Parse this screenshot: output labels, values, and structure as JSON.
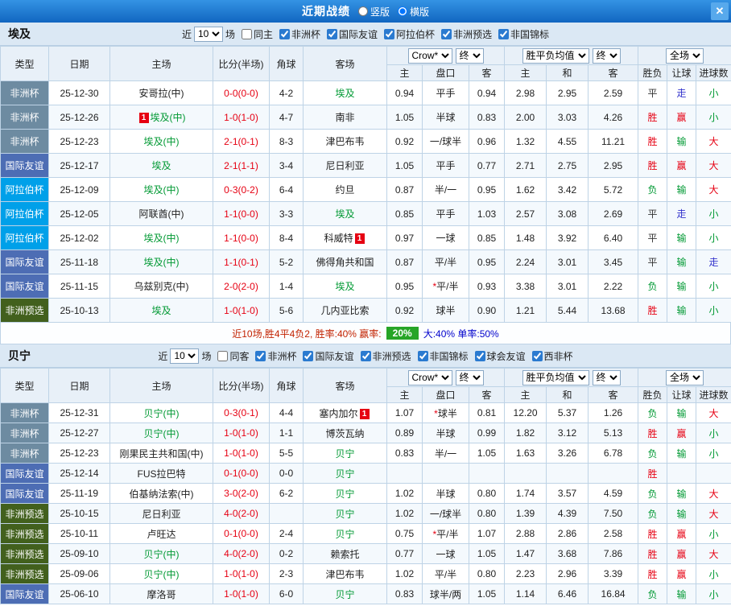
{
  "topbar": {
    "title": "近期战绩",
    "layout_options": [
      {
        "label": "竖版",
        "checked": false
      },
      {
        "label": "横版",
        "checked": true
      }
    ],
    "close_label": "✕"
  },
  "table": {
    "cols": [
      "类型",
      "日期",
      "主场",
      "比分(半场)",
      "角球",
      "客场"
    ],
    "asia_group": {
      "selects": [
        "Crow*",
        "终"
      ],
      "cols": [
        "主",
        "盘口",
        "客"
      ]
    },
    "europe_group": {
      "selects": [
        "胜平负均值",
        "终"
      ],
      "cols": [
        "主",
        "和",
        "客"
      ]
    },
    "result_group": {
      "select": "全场",
      "cols": [
        "胜负",
        "让球",
        "进球数"
      ]
    }
  },
  "colors": {
    "topbar_bg": "#1a74cc",
    "band_bg": "#dbe8f4",
    "score_red": "#e60012",
    "team_highlight": "#009933",
    "summary_badge_bg": "#27a527"
  },
  "type_colors": {
    "非洲杯": "#6d8ba1",
    "国际友谊": "#4d6db4",
    "阿拉伯杯": "#00a0e9",
    "非洲预选": "#42601d"
  },
  "result_colors": {
    "胜": "#e60012",
    "负": "#009933",
    "平": "#333333",
    "赢": "#e60012",
    "输": "#009933",
    "走": "#3333cc",
    "大": "#e60012",
    "小": "#009933"
  },
  "sections": [
    {
      "team": "埃及",
      "filter": {
        "near_label": "近",
        "near_value": "10",
        "unit_label": "场",
        "same_filter": {
          "label": "同主",
          "checked": false
        },
        "comps": [
          {
            "label": "非洲杯",
            "checked": true
          },
          {
            "label": "国际友谊",
            "checked": true
          },
          {
            "label": "阿拉伯杯",
            "checked": true
          },
          {
            "label": "非洲预选",
            "checked": true
          },
          {
            "label": "非国锦标",
            "checked": true
          }
        ]
      },
      "rows": [
        {
          "type": "非洲杯",
          "date": "25-12-30",
          "home": {
            "name": "安哥拉(中)",
            "green": false
          },
          "score": "0-0(0-0)",
          "corner": "4-2",
          "away": {
            "name": "埃及",
            "green": true
          },
          "odds": [
            "0.94",
            "平手",
            "0.94",
            "2.98",
            "2.95",
            "2.59"
          ],
          "results": [
            "平",
            "走",
            "小"
          ]
        },
        {
          "type": "非洲杯",
          "date": "25-12-26",
          "home": {
            "name": "埃及(中)",
            "green": true,
            "badge": "1",
            "badge_pos": "before"
          },
          "score": "1-0(1-0)",
          "corner": "4-7",
          "away": {
            "name": "南非",
            "green": false
          },
          "odds": [
            "1.05",
            "半球",
            "0.83",
            "2.00",
            "3.03",
            "4.26"
          ],
          "results": [
            "胜",
            "赢",
            "小"
          ]
        },
        {
          "type": "非洲杯",
          "date": "25-12-23",
          "home": {
            "name": "埃及(中)",
            "green": true
          },
          "score": "2-1(0-1)",
          "corner": "8-3",
          "away": {
            "name": "津巴布韦",
            "green": false
          },
          "odds": [
            "0.92",
            "一/球半",
            "0.96",
            "1.32",
            "4.55",
            "11.21"
          ],
          "results": [
            "胜",
            "输",
            "大"
          ]
        },
        {
          "type": "国际友谊",
          "date": "25-12-17",
          "home": {
            "name": "埃及",
            "green": true
          },
          "score": "2-1(1-1)",
          "corner": "3-4",
          "away": {
            "name": "尼日利亚",
            "green": false
          },
          "odds": [
            "1.05",
            "平手",
            "0.77",
            "2.71",
            "2.75",
            "2.95"
          ],
          "results": [
            "胜",
            "赢",
            "大"
          ]
        },
        {
          "type": "阿拉伯杯",
          "date": "25-12-09",
          "home": {
            "name": "埃及(中)",
            "green": true
          },
          "score": "0-3(0-2)",
          "corner": "6-4",
          "away": {
            "name": "约旦",
            "green": false
          },
          "odds": [
            "0.87",
            "半/一",
            "0.95",
            "1.62",
            "3.42",
            "5.72"
          ],
          "results": [
            "负",
            "输",
            "大"
          ]
        },
        {
          "type": "阿拉伯杯",
          "date": "25-12-05",
          "home": {
            "name": "阿联酋(中)",
            "green": false
          },
          "score": "1-1(0-0)",
          "corner": "3-3",
          "away": {
            "name": "埃及",
            "green": true
          },
          "odds": [
            "0.85",
            "平手",
            "1.03",
            "2.57",
            "3.08",
            "2.69"
          ],
          "results": [
            "平",
            "走",
            "小"
          ]
        },
        {
          "type": "阿拉伯杯",
          "date": "25-12-02",
          "home": {
            "name": "埃及(中)",
            "green": true
          },
          "score": "1-1(0-0)",
          "corner": "8-4",
          "away": {
            "name": "科威特",
            "green": false,
            "badge": "1",
            "badge_pos": "after"
          },
          "odds": [
            "0.97",
            "一球",
            "0.85",
            "1.48",
            "3.92",
            "6.40"
          ],
          "results": [
            "平",
            "输",
            "小"
          ]
        },
        {
          "type": "国际友谊",
          "date": "25-11-18",
          "home": {
            "name": "埃及(中)",
            "green": true
          },
          "score": "1-1(0-1)",
          "corner": "5-2",
          "away": {
            "name": "佛得角共和国",
            "green": false
          },
          "odds": [
            "0.87",
            "平/半",
            "0.95",
            "2.24",
            "3.01",
            "3.45"
          ],
          "results": [
            "平",
            "输",
            "走"
          ]
        },
        {
          "type": "国际友谊",
          "date": "25-11-15",
          "home": {
            "name": "乌兹别克(中)",
            "green": false
          },
          "score": "2-0(2-0)",
          "corner": "1-4",
          "away": {
            "name": "埃及",
            "green": true
          },
          "odds": [
            "0.95",
            "*平/半",
            "0.93",
            "3.38",
            "3.01",
            "2.22"
          ],
          "results": [
            "负",
            "输",
            "小"
          ]
        },
        {
          "type": "非洲预选",
          "date": "25-10-13",
          "home": {
            "name": "埃及",
            "green": true
          },
          "score": "1-0(1-0)",
          "corner": "5-6",
          "away": {
            "name": "几内亚比索",
            "green": false
          },
          "odds": [
            "0.92",
            "球半",
            "0.90",
            "1.21",
            "5.44",
            "13.68"
          ],
          "results": [
            "胜",
            "输",
            "小"
          ]
        }
      ],
      "summary": {
        "text_red": "近10场,胜4平4负2, 胜率:40% 赢率:",
        "badge": "20%",
        "text_blue": "大:40% 单率:50%"
      }
    },
    {
      "team": "贝宁",
      "filter": {
        "near_label": "近",
        "near_value": "10",
        "unit_label": "场",
        "same_filter": {
          "label": "同客",
          "checked": false
        },
        "comps": [
          {
            "label": "非洲杯",
            "checked": true
          },
          {
            "label": "国际友谊",
            "checked": true
          },
          {
            "label": "非洲预选",
            "checked": true
          },
          {
            "label": "非国锦标",
            "checked": true
          },
          {
            "label": "球会友谊",
            "checked": true
          },
          {
            "label": "西非杯",
            "checked": true
          }
        ]
      },
      "rows": [
        {
          "type": "非洲杯",
          "date": "25-12-31",
          "home": {
            "name": "贝宁(中)",
            "green": true
          },
          "score": "0-3(0-1)",
          "corner": "4-4",
          "away": {
            "name": "塞内加尔",
            "green": false,
            "badge": "1",
            "badge_pos": "after"
          },
          "odds": [
            "1.07",
            "*球半",
            "0.81",
            "12.20",
            "5.37",
            "1.26"
          ],
          "results": [
            "负",
            "输",
            "大"
          ]
        },
        {
          "type": "非洲杯",
          "date": "25-12-27",
          "home": {
            "name": "贝宁(中)",
            "green": true
          },
          "score": "1-0(1-0)",
          "corner": "1-1",
          "away": {
            "name": "博茨瓦纳",
            "green": false
          },
          "odds": [
            "0.89",
            "半球",
            "0.99",
            "1.82",
            "3.12",
            "5.13"
          ],
          "results": [
            "胜",
            "赢",
            "小"
          ]
        },
        {
          "type": "非洲杯",
          "date": "25-12-23",
          "home": {
            "name": "刚果民主共和国(中)",
            "green": false
          },
          "score": "1-0(1-0)",
          "corner": "5-5",
          "away": {
            "name": "贝宁",
            "green": true
          },
          "odds": [
            "0.83",
            "半/一",
            "1.05",
            "1.63",
            "3.26",
            "6.78"
          ],
          "results": [
            "负",
            "输",
            "小"
          ]
        },
        {
          "type": "国际友谊",
          "date": "25-12-14",
          "home": {
            "name": "FUS拉巴特",
            "green": false
          },
          "score": "0-1(0-0)",
          "corner": "0-0",
          "away": {
            "name": "贝宁",
            "green": true
          },
          "odds": [
            "",
            "",
            "",
            "",
            "",
            ""
          ],
          "results": [
            "胜",
            "",
            ""
          ]
        },
        {
          "type": "国际友谊",
          "date": "25-11-19",
          "home": {
            "name": "伯基纳法索(中)",
            "green": false
          },
          "score": "3-0(2-0)",
          "corner": "6-2",
          "away": {
            "name": "贝宁",
            "green": true
          },
          "odds": [
            "1.02",
            "半球",
            "0.80",
            "1.74",
            "3.57",
            "4.59"
          ],
          "results": [
            "负",
            "输",
            "大"
          ]
        },
        {
          "type": "非洲预选",
          "date": "25-10-15",
          "home": {
            "name": "尼日利亚",
            "green": false
          },
          "score": "4-0(2-0)",
          "corner": "",
          "away": {
            "name": "贝宁",
            "green": true
          },
          "odds": [
            "1.02",
            "一/球半",
            "0.80",
            "1.39",
            "4.39",
            "7.50"
          ],
          "results": [
            "负",
            "输",
            "大"
          ]
        },
        {
          "type": "非洲预选",
          "date": "25-10-11",
          "home": {
            "name": "卢旺达",
            "green": false
          },
          "score": "0-1(0-0)",
          "corner": "2-4",
          "away": {
            "name": "贝宁",
            "green": true
          },
          "odds": [
            "0.75",
            "*平/半",
            "1.07",
            "2.88",
            "2.86",
            "2.58"
          ],
          "results": [
            "胜",
            "赢",
            "小"
          ]
        },
        {
          "type": "非洲预选",
          "date": "25-09-10",
          "home": {
            "name": "贝宁(中)",
            "green": true
          },
          "score": "4-0(2-0)",
          "corner": "0-2",
          "away": {
            "name": "赖索托",
            "green": false
          },
          "odds": [
            "0.77",
            "一球",
            "1.05",
            "1.47",
            "3.68",
            "7.86"
          ],
          "results": [
            "胜",
            "赢",
            "大"
          ]
        },
        {
          "type": "非洲预选",
          "date": "25-09-06",
          "home": {
            "name": "贝宁(中)",
            "green": true
          },
          "score": "1-0(1-0)",
          "corner": "2-3",
          "away": {
            "name": "津巴布韦",
            "green": false
          },
          "odds": [
            "1.02",
            "平/半",
            "0.80",
            "2.23",
            "2.96",
            "3.39"
          ],
          "results": [
            "胜",
            "赢",
            "小"
          ]
        },
        {
          "type": "国际友谊",
          "date": "25-06-10",
          "home": {
            "name": "摩洛哥",
            "green": false
          },
          "score": "1-0(1-0)",
          "corner": "6-0",
          "away": {
            "name": "贝宁",
            "green": true
          },
          "odds": [
            "0.83",
            "球半/两",
            "1.05",
            "1.14",
            "6.46",
            "16.84"
          ],
          "results": [
            "负",
            "输",
            "小"
          ]
        }
      ]
    }
  ]
}
